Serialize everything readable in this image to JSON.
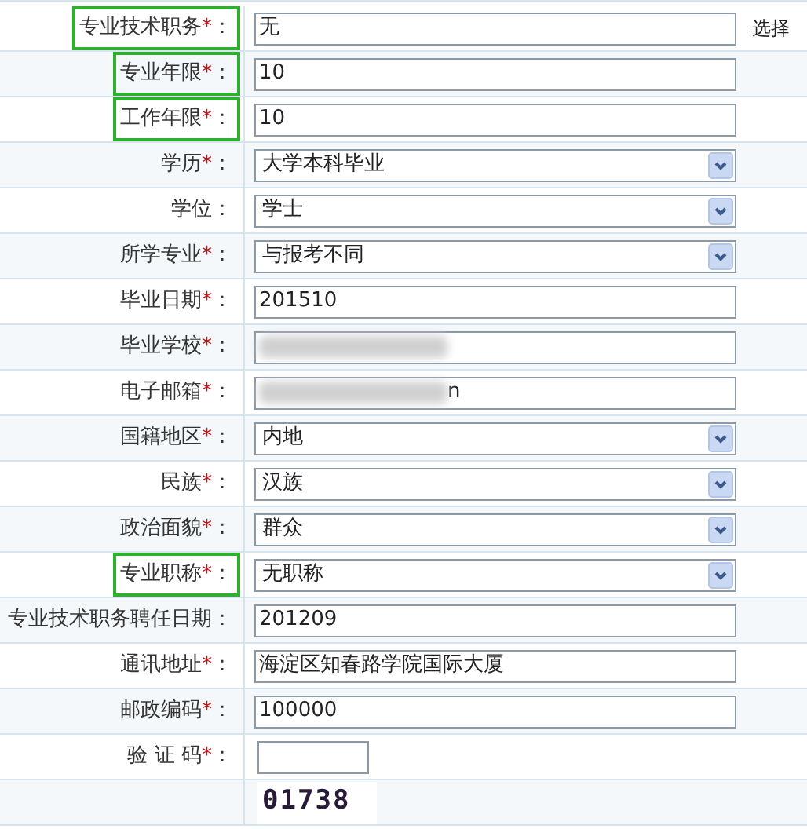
{
  "rows": [
    {
      "label": "专业技术职务",
      "required_mark": "*",
      "colon": "：",
      "highlighted": true,
      "kind": "text",
      "value": "无",
      "action": "选择"
    },
    {
      "label": "专业年限",
      "required_mark": "*",
      "colon": "：",
      "highlighted": true,
      "kind": "text",
      "value": "10"
    },
    {
      "label": "工作年限",
      "required_mark": "*",
      "colon": "：",
      "highlighted": true,
      "kind": "text",
      "value": "10"
    },
    {
      "label": "学历",
      "required_mark": "*",
      "colon": "：",
      "highlighted": false,
      "kind": "select",
      "value": "大学本科毕业"
    },
    {
      "label": "学位",
      "colon": "：",
      "highlighted": false,
      "kind": "select",
      "value": "学士"
    },
    {
      "label": "所学专业",
      "required_mark": "*",
      "colon": "：",
      "highlighted": false,
      "kind": "select",
      "value": "与报考不同"
    },
    {
      "label": "毕业日期",
      "required_mark": "*",
      "colon": "：",
      "highlighted": false,
      "kind": "text",
      "value": "201510"
    },
    {
      "label": "毕业学校",
      "required_mark": "*",
      "colon": "：",
      "highlighted": false,
      "kind": "text",
      "redacted": true
    },
    {
      "label": "电子邮箱",
      "required_mark": "*",
      "colon": "：",
      "highlighted": false,
      "kind": "text",
      "redacted": true,
      "value": "n"
    },
    {
      "label": "国籍地区",
      "required_mark": "*",
      "colon": "：",
      "highlighted": false,
      "kind": "select",
      "value": "内地"
    },
    {
      "label": "民族",
      "required_mark": "*",
      "colon": "：",
      "highlighted": false,
      "kind": "select",
      "value": "汉族"
    },
    {
      "label": "政治面貌",
      "required_mark": "*",
      "colon": "：",
      "highlighted": false,
      "kind": "select",
      "value": "群众"
    },
    {
      "label": "专业职称",
      "required_mark": "*",
      "colon": "：",
      "highlighted": true,
      "kind": "select",
      "value": "无职称"
    },
    {
      "label": "专业技术职务聘任日期",
      "colon": "：",
      "highlighted": false,
      "kind": "text",
      "value": "201209"
    },
    {
      "label": "通讯地址",
      "required_mark": "*",
      "colon": "：",
      "highlighted": false,
      "kind": "text",
      "value": "海淀区知春路学院国际大厦"
    },
    {
      "label": "邮政编码",
      "required_mark": "*",
      "colon": "：",
      "highlighted": false,
      "kind": "text",
      "value": "100000"
    },
    {
      "label": "验 证 码",
      "required_mark": "*",
      "colon": "：",
      "highlighted": false,
      "kind": "short"
    },
    {
      "kind": "captcha",
      "value": "01738"
    }
  ]
}
